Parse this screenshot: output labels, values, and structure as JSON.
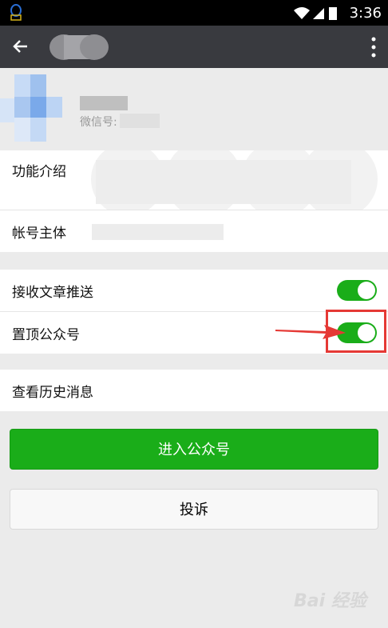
{
  "status_bar": {
    "time": "3:36",
    "notification_icon": "qq-notification-icon",
    "signal_icons": [
      "wifi-icon",
      "signal-icon",
      "battery-charging-icon"
    ]
  },
  "app_bar": {
    "back_icon": "back-arrow-icon",
    "menu_icon": "more-vert-icon"
  },
  "profile": {
    "wechat_id_label": "微信号:"
  },
  "info_section": [
    {
      "label": "功能介绍"
    },
    {
      "label": "帐号主体"
    }
  ],
  "toggles": [
    {
      "label": "接收文章推送",
      "on": true
    },
    {
      "label": "置顶公众号",
      "on": true
    }
  ],
  "history": {
    "label": "查看历史消息"
  },
  "buttons": {
    "enter": "进入公众号",
    "complain": "投诉"
  },
  "watermark": "Bai 经验",
  "colors": {
    "accent_green": "#1aad19",
    "app_bar": "#393a3f",
    "highlight_red": "#e53935"
  }
}
